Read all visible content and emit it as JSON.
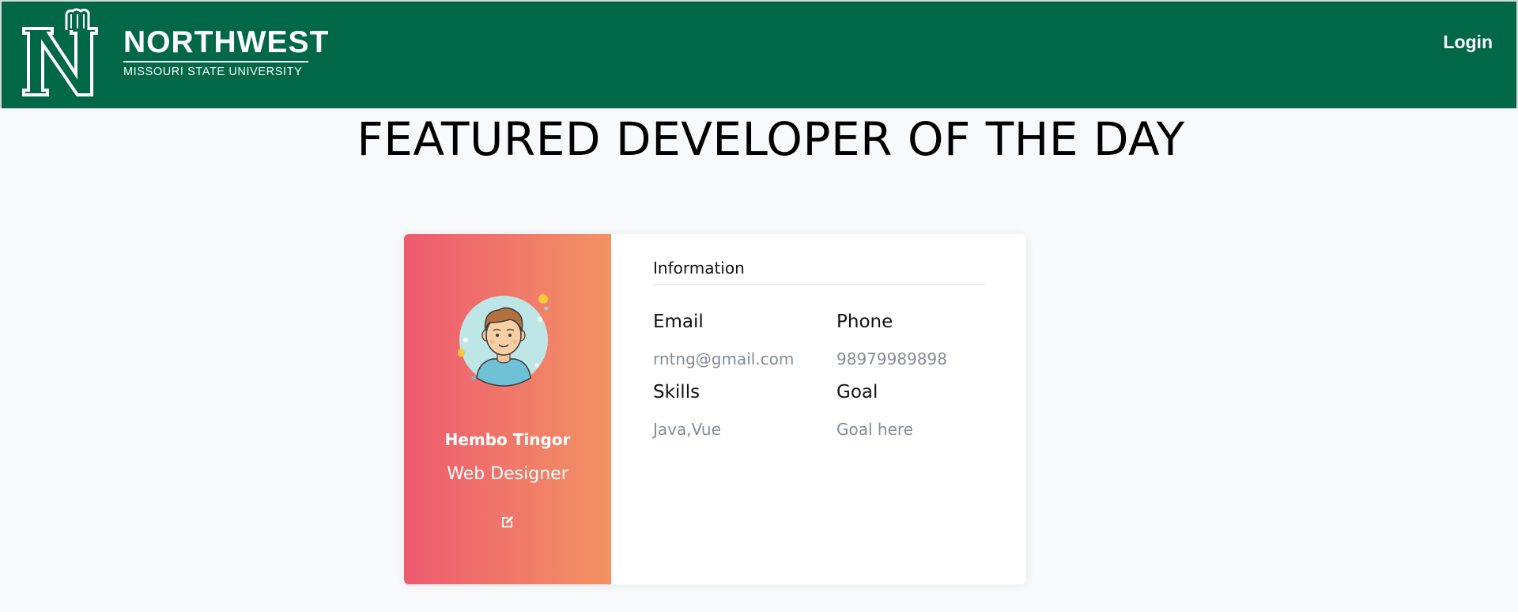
{
  "header": {
    "brand_name": "NORTHWEST",
    "brand_subtitle": "MISSOURI STATE UNIVERSITY",
    "brand_color": "#006747",
    "login_label": "Login"
  },
  "page": {
    "title": "FEATURED DEVELOPER OF THE DAY"
  },
  "profile": {
    "name": "Hembo Tingor",
    "role": "Web Designer",
    "gradient": [
      "#ee5a70",
      "#f29363"
    ],
    "edit_icon": "edit-icon",
    "info_heading": "Information",
    "fields": {
      "email": {
        "label": "Email",
        "value": "rntng@gmail.com"
      },
      "phone": {
        "label": "Phone",
        "value": "98979989898"
      },
      "skills": {
        "label": "Skills",
        "value": "Java,Vue"
      },
      "goal": {
        "label": "Goal",
        "value": "Goal here"
      }
    }
  }
}
